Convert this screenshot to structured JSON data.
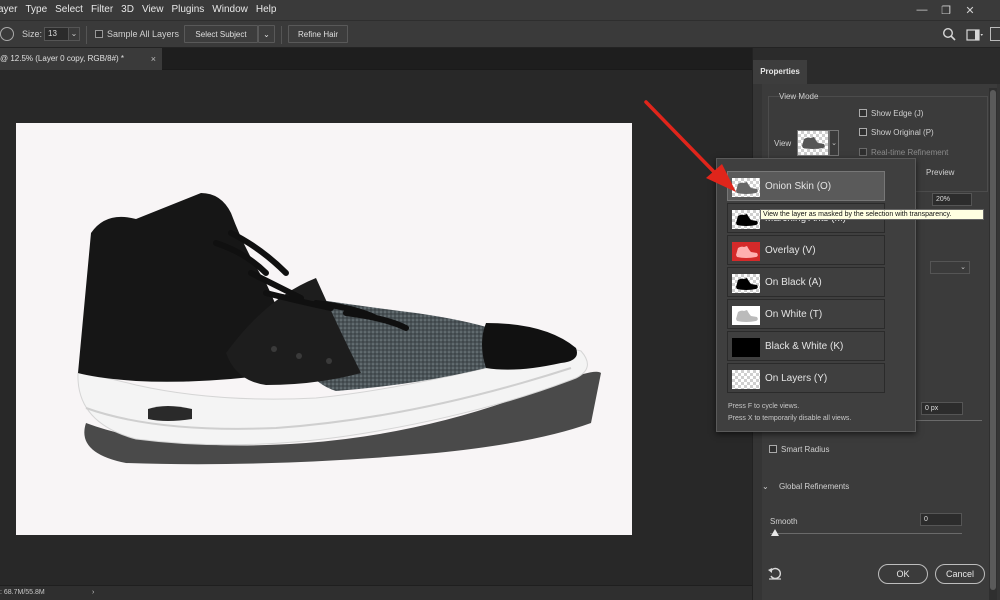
{
  "menubar": {
    "items": [
      "ayer",
      "Type",
      "Select",
      "Filter",
      "3D",
      "View",
      "Plugins",
      "Window",
      "Help"
    ],
    "window_controls": [
      "minimize",
      "restore",
      "close"
    ]
  },
  "options_bar": {
    "size_label": "Size:",
    "size_value": "13",
    "sample_all_layers_label": "Sample All Layers",
    "select_subject_label": "Select Subject",
    "refine_hair_label": "Refine Hair"
  },
  "document": {
    "tab_title": "@ 12.5% (Layer 0 copy, RGB/8#) *",
    "tab_close": "×"
  },
  "status_bar": {
    "doc_info": ": 68.7M/55.8M",
    "arrow": "›"
  },
  "properties_panel": {
    "tab_label": "Properties",
    "view_mode_heading": "View Mode",
    "view_label": "View",
    "show_edge_label": "Show Edge (J)",
    "show_original_label": "Show Original (P)",
    "realtime_refinement_label": "Real-time Refinement",
    "preview_label": "Preview",
    "opacity_value": "20%",
    "radius_value": "0 px",
    "smart_radius_label": "Smart Radius",
    "global_refinements_label": "Global Refinements",
    "smooth_label": "Smooth",
    "smooth_value": "0",
    "ok_label": "OK",
    "cancel_label": "Cancel"
  },
  "view_popup": {
    "options": [
      {
        "label": "Onion Skin (O)",
        "selected": true
      },
      {
        "label": "Marching Ants (M)",
        "selected": false
      },
      {
        "label": "Overlay (V)",
        "selected": false
      },
      {
        "label": "On Black (A)",
        "selected": false
      },
      {
        "label": "On White (T)",
        "selected": false
      },
      {
        "label": "Black & White (K)",
        "selected": false
      },
      {
        "label": "On Layers (Y)",
        "selected": false
      }
    ],
    "hint_1": "Press F to cycle views.",
    "hint_2": "Press X to temporarily disable all views.",
    "tooltip": "View the layer as masked by the selection with transparency."
  },
  "colors": {
    "annotation_arrow": "#e0251b",
    "overlay_red": "#d42a2a"
  }
}
